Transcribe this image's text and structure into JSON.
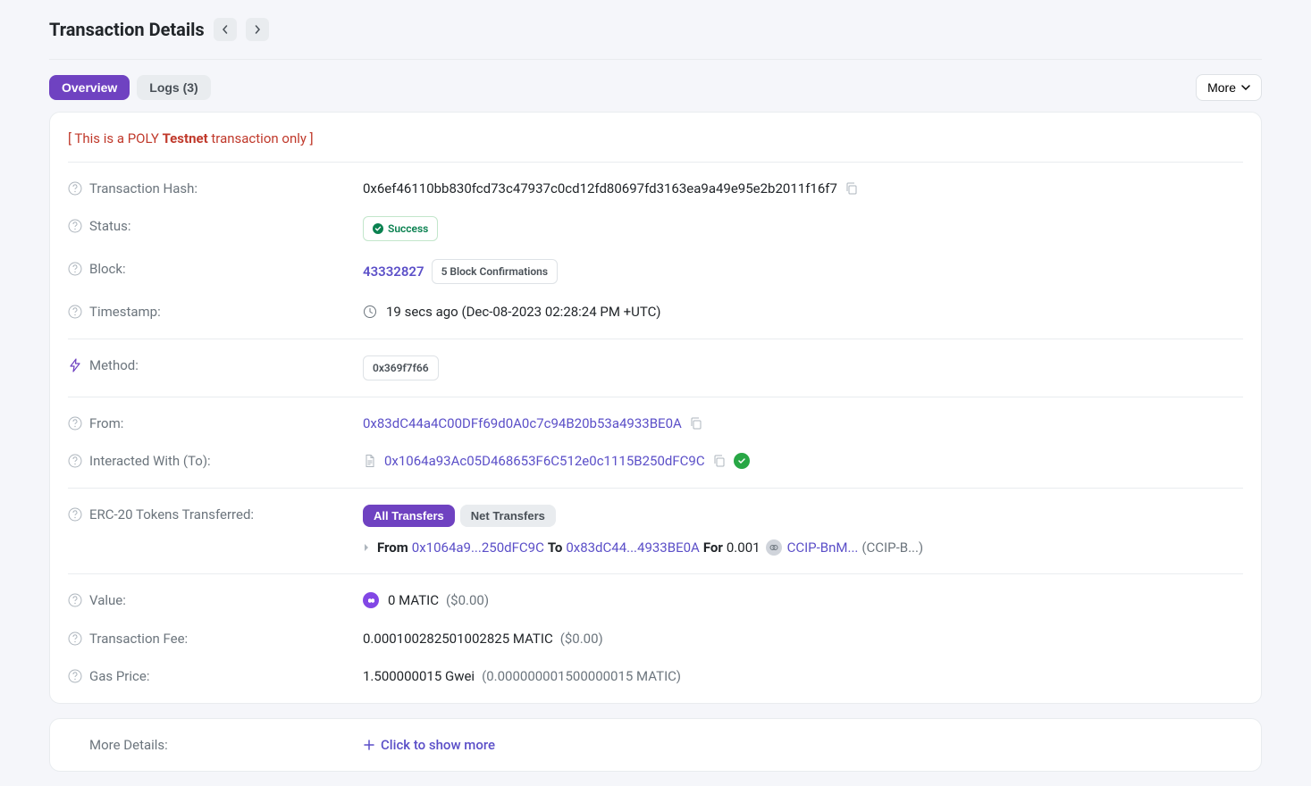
{
  "header": {
    "title": "Transaction Details"
  },
  "tabs": {
    "overview": "Overview",
    "logs": "Logs (3)",
    "more": "More"
  },
  "notice": {
    "prefix": "[ This is a POLY ",
    "bold": "Testnet",
    "suffix": " transaction only ]"
  },
  "labels": {
    "txhash": "Transaction Hash:",
    "status": "Status:",
    "block": "Block:",
    "timestamp": "Timestamp:",
    "method": "Method:",
    "from": "From:",
    "to": "Interacted With (To):",
    "erc20": "ERC-20 Tokens Transferred:",
    "value": "Value:",
    "txfee": "Transaction Fee:",
    "gasprice": "Gas Price:",
    "moredetails": "More Details:"
  },
  "values": {
    "txhash": "0x6ef46110bb830fcd73c47937c0cd12fd80697fd3163ea9a49e95e2b2011f16f7",
    "status": "Success",
    "block": "43332827",
    "confirmations": "5 Block Confirmations",
    "timestamp": "19 secs ago (Dec-08-2023 02:28:24 PM +UTC)",
    "method": "0x369f7f66",
    "from": "0x83dC44a4C00DFf69d0A0c7c94B20b53a4933BE0A",
    "to": "0x1064a93Ac05D468653F6C512e0c1115B250dFC9C",
    "all_transfers": "All Transfers",
    "net_transfers": "Net Transfers",
    "transfer_from_label": "From",
    "transfer_from": "0x1064a9...250dFC9C",
    "transfer_to_label": "To",
    "transfer_to": "0x83dC44...4933BE0A",
    "transfer_for_label": "For",
    "transfer_amount": "0.001",
    "token_name": "CCIP-BnM...",
    "token_symbol": "(CCIP-B...)",
    "value_amount": "0 MATIC",
    "value_usd": "($0.00)",
    "txfee_amount": "0.000100282501002825 MATIC",
    "txfee_usd": "($0.00)",
    "gasprice_gwei": "1.500000015 Gwei",
    "gasprice_matic": "(0.000000001500000015 MATIC)",
    "show_more": "Click to show more"
  }
}
